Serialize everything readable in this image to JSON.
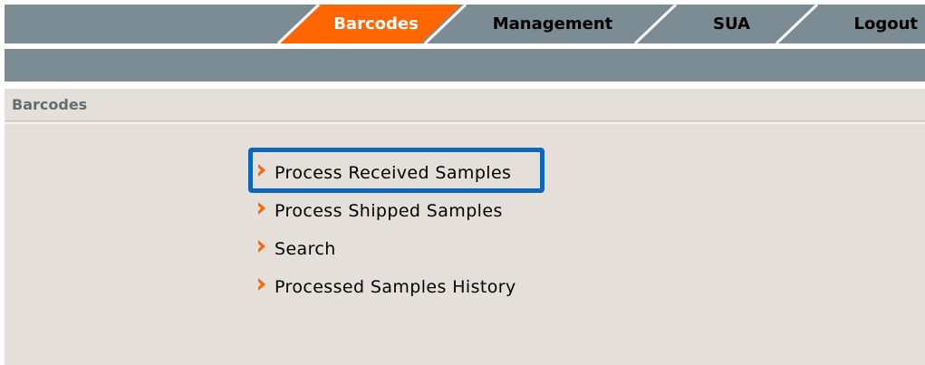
{
  "tabs": {
    "barcodes": "Barcodes",
    "management": "Management",
    "sua": "SUA",
    "logout": "Logout"
  },
  "section": {
    "title": "Barcodes"
  },
  "menu": {
    "items": [
      "Process Received Samples",
      "Process Shipped Samples",
      "Search",
      "Processed Samples History"
    ]
  },
  "colors": {
    "accent": "#ff6600",
    "bar": "#7b8c94",
    "highlight": "#0d66b9",
    "background": "#e4e0d9"
  }
}
